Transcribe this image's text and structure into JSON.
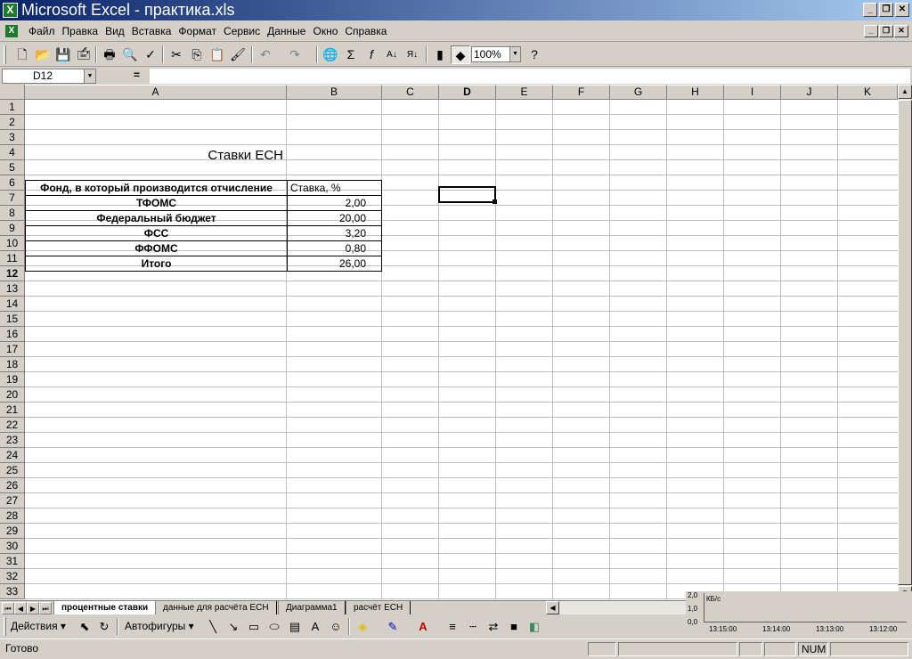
{
  "window": {
    "title": "Microsoft Excel - практика.xls",
    "app_icon": "excel-icon",
    "minimize_glyph": "_",
    "maximize_glyph": "❐",
    "close_glyph": "✕"
  },
  "menu": {
    "items": [
      "Файл",
      "Правка",
      "Вид",
      "Вставка",
      "Формат",
      "Сервис",
      "Данные",
      "Окно",
      "Справка"
    ]
  },
  "toolbar": {
    "icons": [
      "new-icon",
      "open-icon",
      "save-icon",
      "permission-icon",
      "print-icon",
      "print-preview-icon",
      "spelling-icon",
      "cut-icon",
      "copy-icon",
      "paste-icon",
      "format-painter-icon",
      "undo-icon",
      "redo-icon",
      "hyperlink-icon",
      "autosum-icon",
      "function-icon",
      "sort-asc-icon",
      "sort-desc-icon",
      "chart-wizard-icon",
      "map-icon",
      "help-icon"
    ],
    "zoom": "100%"
  },
  "formula_bar": {
    "name_box": "D12",
    "equals_label": "=",
    "formula": ""
  },
  "grid": {
    "columns": [
      "A",
      "B",
      "C",
      "D",
      "E",
      "F",
      "G",
      "H",
      "I",
      "J",
      "K"
    ],
    "active_column": "D",
    "active_row": 12,
    "rows": [
      "1",
      "2",
      "3",
      "4",
      "5",
      "6",
      "7",
      "8",
      "9",
      "10",
      "11",
      "12",
      "13",
      "14",
      "15",
      "16",
      "17",
      "18",
      "19",
      "20",
      "21",
      "22",
      "23",
      "24",
      "25",
      "26",
      "27",
      "28",
      "29",
      "30",
      "31",
      "32",
      "33"
    ],
    "cells": {
      "title": "Ставки ЕСН",
      "header_fund": "Фонд, в который производится отчисление",
      "header_rate": "Ставка, %",
      "rows": [
        {
          "fund": "ТФОМС",
          "rate": "2,00"
        },
        {
          "fund": "Федеральный бюджет",
          "rate": "20,00"
        },
        {
          "fund": "ФСС",
          "rate": "3,20"
        },
        {
          "fund": "ФФОМС",
          "rate": "0,80"
        },
        {
          "fund": "Итого",
          "rate": "26,00"
        }
      ]
    }
  },
  "sheet_tabs": [
    "процентные ставки",
    "данные для расчёта ЕСН",
    "Диаграмма1",
    "расчёт ЕСН"
  ],
  "active_tab": "процентные ставки",
  "net_graph": {
    "unit": "КБ/с",
    "y_labels": [
      "2,0",
      "1,0",
      "0,0"
    ],
    "x_labels": [
      "13:15:00",
      "13:14:00",
      "13:13:00",
      "13:12:00"
    ]
  },
  "drawing_toolbar": {
    "actions_label": "Действия",
    "autoshapes_label": "Автофигуры",
    "arrow": "▾"
  },
  "status": {
    "text": "Готово",
    "num": "NUM"
  },
  "colors": {
    "title_gradient_start": "#0a246a",
    "title_gradient_end": "#a6caf0",
    "excel_green": "#1d7a2e"
  }
}
